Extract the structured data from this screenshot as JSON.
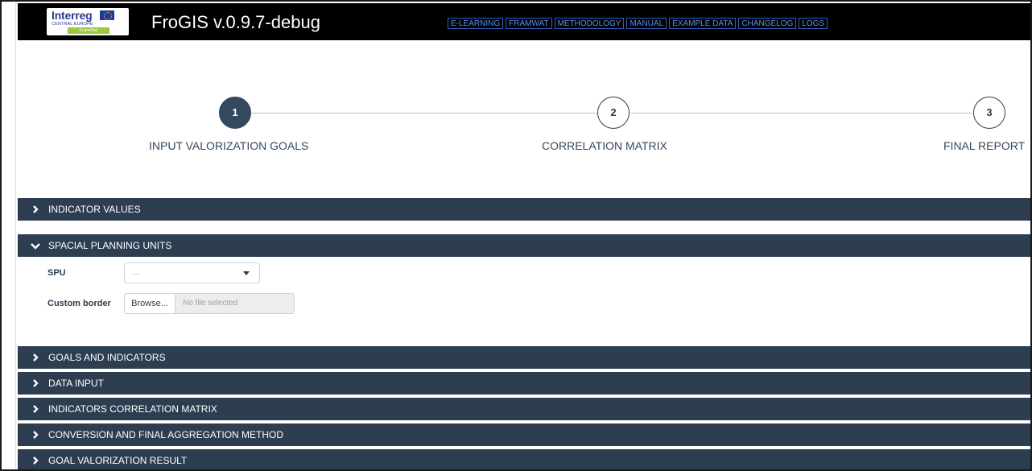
{
  "app": {
    "logo_word": "Interreg",
    "logo_sub": "CENTRAL EUROPE",
    "logo_tag": "FramWat",
    "title": "FroGIS v.0.9.7-debug"
  },
  "nav": {
    "links": [
      "E-LEARNING",
      "FRAMWAT",
      "METHODOLOGY",
      "MANUAL",
      "EXAMPLE DATA",
      "CHANGELOG",
      "LOGS"
    ]
  },
  "stepper": {
    "steps": [
      {
        "number": "1",
        "label": "INPUT VALORIZATION GOALS",
        "active": true
      },
      {
        "number": "2",
        "label": "CORRELATION MATRIX",
        "active": false
      },
      {
        "number": "3",
        "label": "FINAL REPORT",
        "active": false
      }
    ]
  },
  "panels": {
    "indicator_values": "INDICATOR VALUES",
    "spacial_planning_units": "SPACIAL PLANNING UNITS",
    "goals_and_indicators": "GOALS AND INDICATORS",
    "data_input": "DATA INPUT",
    "indicators_correlation_matrix": "INDICATORS CORRELATION MATRIX",
    "conversion_method": "CONVERSION AND FINAL AGGREGATION METHOD",
    "goal_valorization_result": "GOAL VALORIZATION RESULT"
  },
  "spu_form": {
    "spu_label": "SPU",
    "spu_value": "...",
    "custom_border_label": "Custom border",
    "browse_label": "Browse...",
    "file_placeholder": "No file selected"
  },
  "colors": {
    "header_bg": "#000000",
    "panel_bg": "#2c3e50",
    "nav_link": "#5b8ef0",
    "step_active": "#34495e"
  }
}
